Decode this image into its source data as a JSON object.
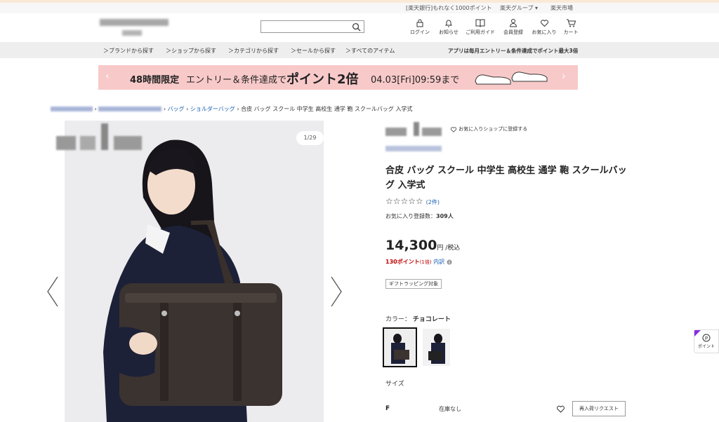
{
  "util": {
    "bank": "[楽天銀行]もれなく1000ポイント",
    "group": "楽天グループ ▾",
    "ichiba": "楽天市場"
  },
  "header": {
    "search_placeholder": "",
    "nav": [
      {
        "label": "ログイン",
        "icon": "lock-icon"
      },
      {
        "label": "お知らせ",
        "icon": "bell-icon"
      },
      {
        "label": "ご利用ガイド",
        "icon": "book-icon"
      },
      {
        "label": "会員登録",
        "icon": "person-icon"
      },
      {
        "label": "お気に入り",
        "icon": "heart-icon"
      },
      {
        "label": "カート",
        "icon": "cart-icon"
      }
    ]
  },
  "category_bar": {
    "items": [
      "＞ブランドから探す",
      "＞ショップから探す",
      "＞カテゴリから探す",
      "＞セールから探す",
      "＞すべてのアイテム"
    ],
    "promo": "アプリは毎月エントリー＆条件達成でポイント最大3倍"
  },
  "banner": {
    "limited": "48時間限定",
    "entry": "エントリー＆条件達成で",
    "points": "ポイント2倍",
    "deadline": "04.03[Fri]09:59まで",
    "color": "#f8c9c9"
  },
  "breadcrumb": {
    "items": [
      "バッグ",
      "ショルダーバッグ"
    ],
    "current": "合皮 バッグ スクール 中学生 高校生 通学 鞄 スクールバッグ 入学式"
  },
  "gallery": {
    "counter": "1/29"
  },
  "product": {
    "fav_shop": "お気に入りショップに登録する",
    "title": "合皮 バッグ スクール 中学生 高校生 通学 鞄 スクールバッグ 入学式",
    "stars": "☆☆☆☆☆",
    "review_count": "(2件)",
    "fav_count_label": "お気に入り登録数：",
    "fav_count": "309人",
    "price": "14,300",
    "price_unit": "円 /税込",
    "points": "130ポイント",
    "points_rate": "(1倍)",
    "points_detail": "内訳",
    "gift": "ギフトラッピング対象",
    "color_label": "カラー：",
    "color_value": "チョコレート",
    "size_label": "サイズ",
    "size_value": "F",
    "stock": "在庫なし",
    "restock_button": "再入荷リクエスト"
  },
  "side_button": {
    "label": "ポイント"
  }
}
